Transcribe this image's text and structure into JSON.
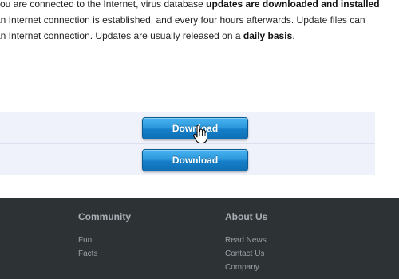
{
  "intro": {
    "line1_pre": "you are connected to the Internet, virus database ",
    "line1_bold": "updates are downloaded and installed",
    "line2": "an Internet connection is established, and every four hours afterwards. Update files can",
    "line3_pre": "an Internet connection. Updates are usually released on a ",
    "line3_bold": "daily basis",
    "line3_post": "."
  },
  "downloads": [
    {
      "button_label": "Download"
    },
    {
      "button_label": "Download"
    }
  ],
  "footer": {
    "community": {
      "heading": "Community",
      "links": [
        "Fun",
        "Facts"
      ]
    },
    "about": {
      "heading": "About Us",
      "links": [
        "Read News",
        "Contact Us",
        "Company"
      ]
    }
  },
  "colors": {
    "button_blue": "#2c98dd",
    "row_bg": "#eff1fb",
    "footer_bg": "#2d3235"
  }
}
